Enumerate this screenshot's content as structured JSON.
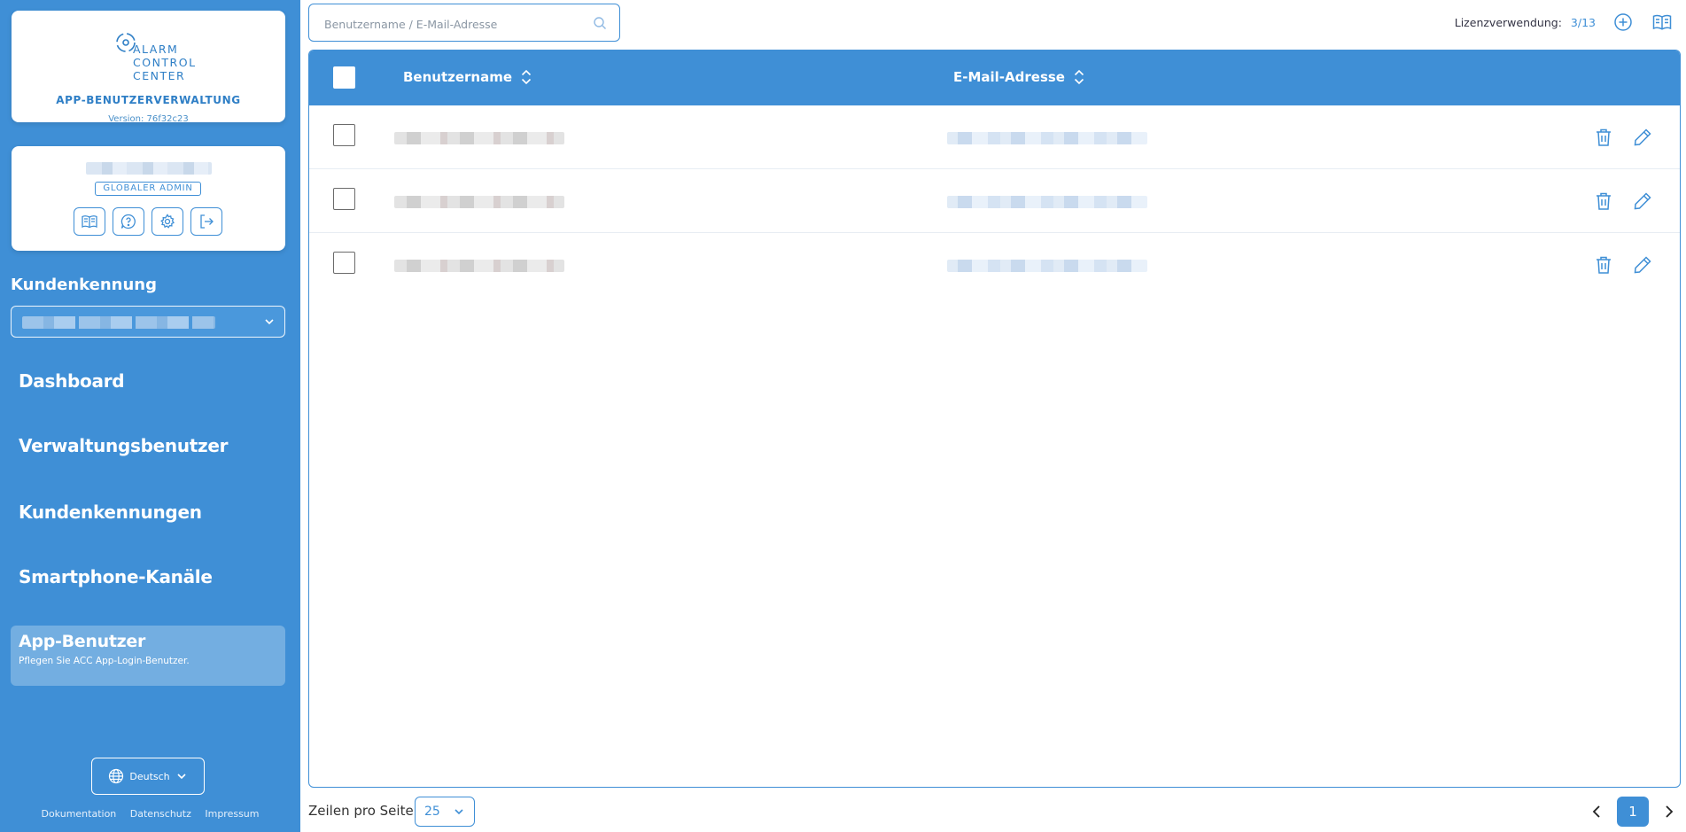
{
  "brand": {
    "logo_lines": [
      "ALARM",
      "CONTROL",
      "CENTER"
    ],
    "app_title": "APP-BENUTZERVERWALTUNG",
    "version": "Version: 76f32c23"
  },
  "user_card": {
    "role": "GLOBALER ADMIN",
    "buttons": [
      "book-icon",
      "help-icon",
      "gear-icon",
      "logout-icon"
    ]
  },
  "customer": {
    "label": "Kundenkennung"
  },
  "nav": {
    "items": [
      "Dashboard",
      "Verwaltungsbenutzer",
      "Kundenkennungen",
      "Smartphone-Kanäle"
    ],
    "active": {
      "title": "App-Benutzer",
      "subtitle": "Pflegen Sie ACC App-Login-Benutzer."
    }
  },
  "language": {
    "selected": "Deutsch"
  },
  "footer": {
    "links": [
      "Dokumentation",
      "Datenschutz",
      "Impressum"
    ]
  },
  "search": {
    "placeholder": "Benutzername / E-Mail-Adresse"
  },
  "license": {
    "label": "Lizenzverwendung:",
    "value": "3/13"
  },
  "table": {
    "columns": [
      "Benutzername",
      "E-Mail-Adresse"
    ],
    "row_count": 3
  },
  "pagination": {
    "rows_label": "Zeilen pro Seite",
    "rows_per_page": "25",
    "current_page": "1"
  },
  "colors": {
    "primary": "#3f8fd6",
    "active_nav": "#73aee1"
  }
}
